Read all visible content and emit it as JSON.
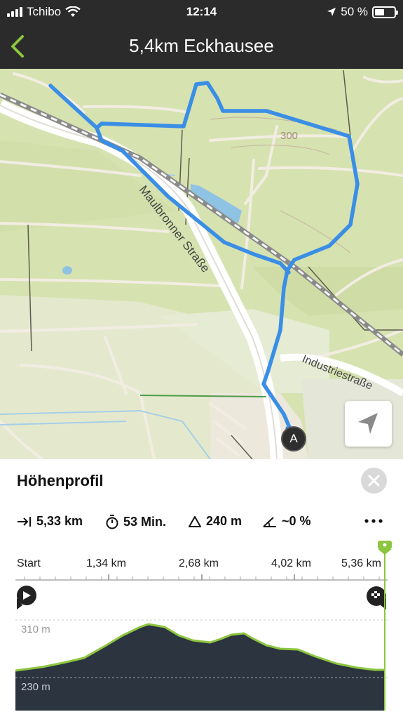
{
  "status_bar": {
    "carrier": "Tchibo",
    "time": "12:14",
    "battery": "50 %",
    "battery_level": 0.5
  },
  "nav": {
    "title": "5,4km Eckhausee",
    "back_icon": "chevron-left-icon",
    "accent_color": "#8cc63f"
  },
  "map": {
    "labels": {
      "street_1": "Maulbronner Straße",
      "street_2": "Industriestraße",
      "elevation": "300"
    },
    "marker": "A",
    "route_color": "#3a8ee6",
    "locate_icon": "navigation-arrow-icon"
  },
  "panel": {
    "title": "Höhenprofil",
    "close_icon": "close-icon",
    "stats": {
      "distance": "5,33 km",
      "duration": "53 Min.",
      "ascent": "240 m",
      "gradient": "~0 %"
    },
    "more_icon": "more-horizontal-icon",
    "axis_ticks": [
      "Start",
      "1,34 km",
      "2,68 km",
      "4,02 km",
      "5,36 km"
    ],
    "elevation_labels": {
      "upper": "310 m",
      "lower": "230 m"
    },
    "start_icon": "play-icon",
    "finish_icon": "finish-flag-icon",
    "profile_fill_color": "#2c3440",
    "profile_line_color": "#8cc63f"
  }
}
